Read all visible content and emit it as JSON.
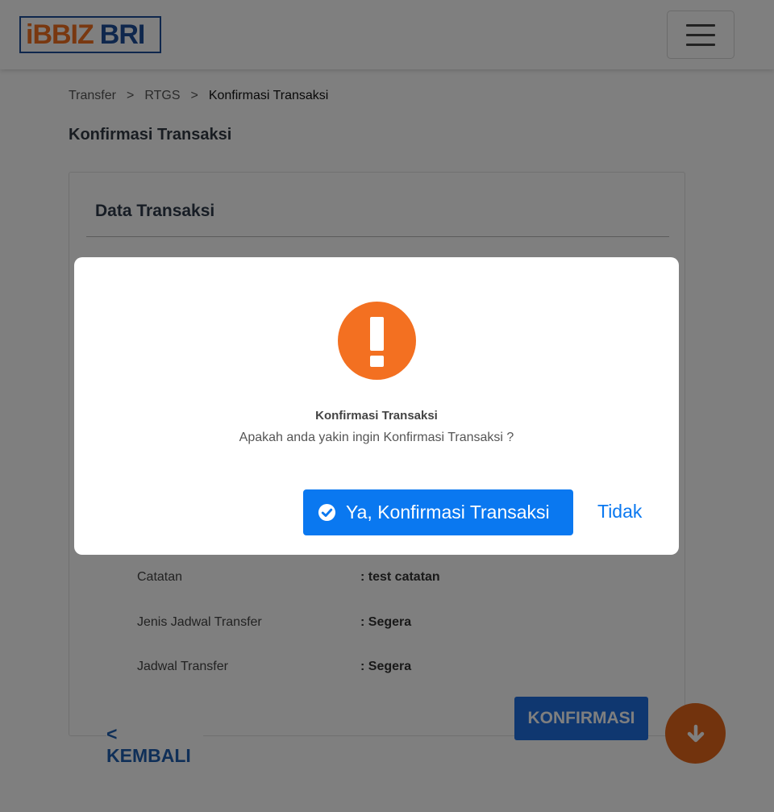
{
  "header": {
    "logo_left": "iBBIZ",
    "logo_right": "BRI",
    "menu_icon": "hamburger-menu-icon"
  },
  "breadcrumb": {
    "items": [
      "Transfer",
      "RTGS",
      "Konfirmasi Transaksi"
    ],
    "separator": ">"
  },
  "page": {
    "title": "Konfirmasi Transaksi"
  },
  "card": {
    "title": "Data Transaksi",
    "rows": [
      {
        "label": "Catatan",
        "value": ": test catatan"
      },
      {
        "label": "Jenis Jadwal Transfer",
        "value": ": Segera"
      },
      {
        "label": "Jadwal Transfer",
        "value": ": Segera"
      }
    ]
  },
  "actions": {
    "back_label": "< KEMBALI",
    "confirm_label": "KONFIRMASI",
    "scroll_icon": "arrow-down-icon"
  },
  "modal": {
    "icon": "exclamation-icon",
    "title": "Konfirmasi Transaksi",
    "message": "Apakah anda yakin ingin Konfirmasi Transaksi ?",
    "yes_label": "Ya, Konfirmasi Transaksi",
    "no_label": "Tidak"
  },
  "colors": {
    "brand_orange": "#f37021",
    "brand_blue": "#1f4e9a",
    "primary_button": "#0a78f0",
    "overlay": "rgba(0,0,0,0.5)"
  }
}
